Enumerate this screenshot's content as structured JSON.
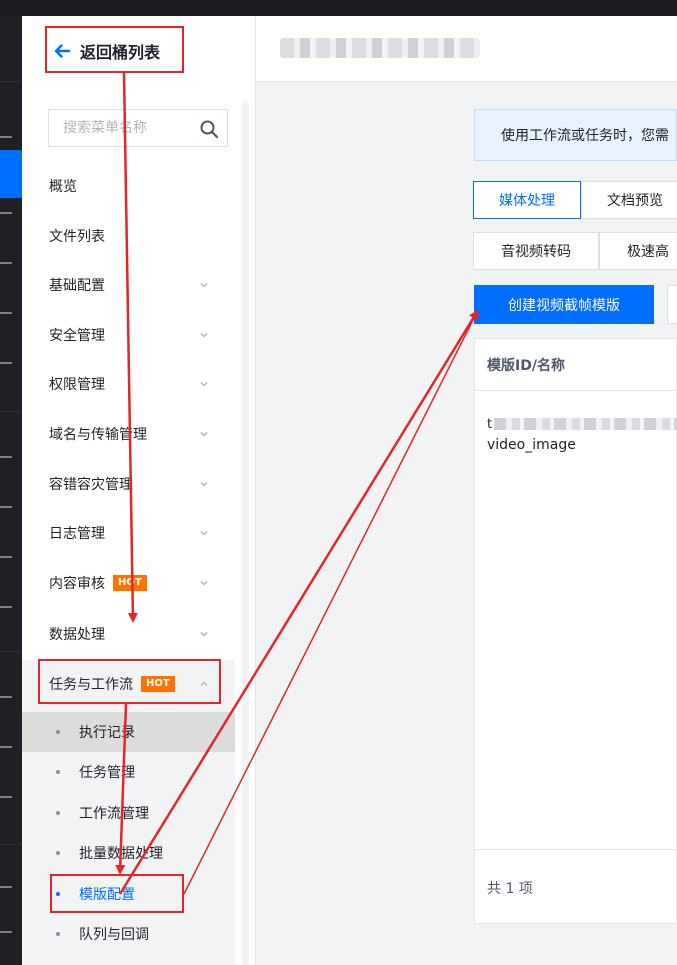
{
  "sidebar": {
    "back_label": "返回桶列表",
    "search_placeholder": "搜索菜单名称",
    "items": [
      {
        "label": "概览"
      },
      {
        "label": "文件列表"
      },
      {
        "label": "基础配置"
      },
      {
        "label": "安全管理"
      },
      {
        "label": "权限管理"
      },
      {
        "label": "域名与传输管理"
      },
      {
        "label": "容错容灾管理"
      },
      {
        "label": "日志管理"
      },
      {
        "label": "内容审核",
        "badge": "HOT"
      },
      {
        "label": "数据处理"
      },
      {
        "label": "任务与工作流",
        "badge": "HOT"
      }
    ],
    "sub_items": [
      {
        "label": "执行记录"
      },
      {
        "label": "任务管理"
      },
      {
        "label": "工作流管理"
      },
      {
        "label": "批量数据处理"
      },
      {
        "label": "模版配置"
      },
      {
        "label": "队列与回调"
      }
    ]
  },
  "main": {
    "notice": "使用工作流或任务时，您需",
    "tabs_primary": [
      {
        "label": "媒体处理"
      },
      {
        "label": "文档预览"
      }
    ],
    "tabs_secondary": [
      {
        "label": "音视频转码"
      },
      {
        "label": "极速高"
      }
    ],
    "create_button": "创建视频截帧模版",
    "table": {
      "header": "模版ID/名称",
      "row": {
        "id_prefix": "t",
        "name": "video_image"
      },
      "footer": "共 1 项"
    }
  },
  "colors": {
    "accent": "#006eff",
    "hot_badge": "#ff7200",
    "annotation": "#e5252a"
  }
}
